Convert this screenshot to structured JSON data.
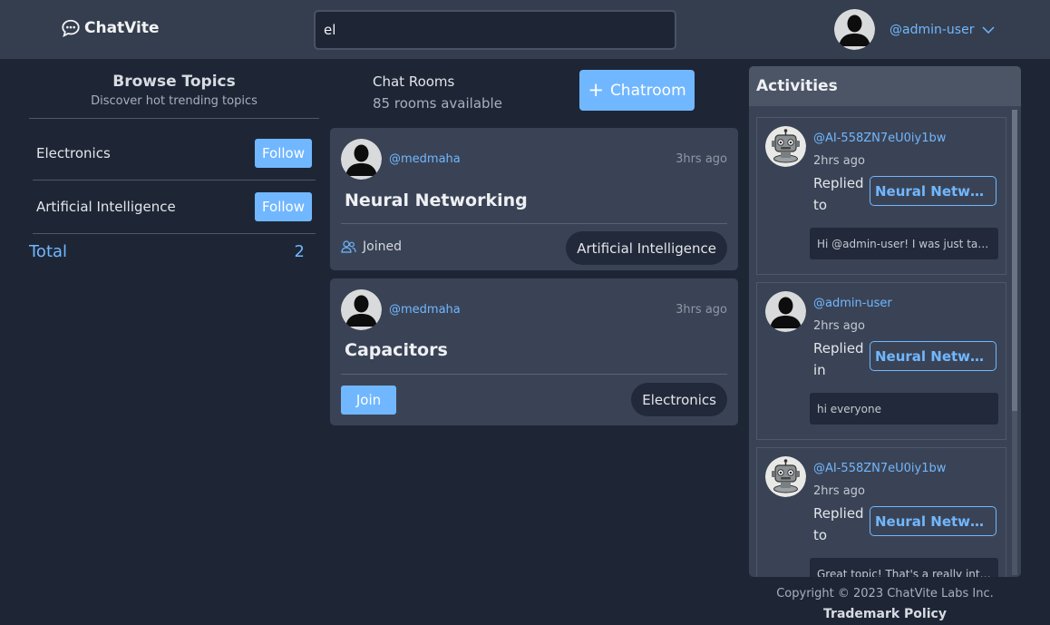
{
  "header": {
    "logo_text": "ChatVite",
    "logo_icon": "chat-bubble-icon",
    "search": {
      "value": "el",
      "placeholder": ""
    },
    "user": {
      "handle": "@admin-user",
      "dropdown_icon": "chevron-down-icon"
    }
  },
  "topics": {
    "title": "Browse Topics",
    "subtitle": "Discover hot trending topics",
    "items": [
      {
        "name": "Electronics",
        "button": "Follow"
      },
      {
        "name": "Artificial Intelligence",
        "button": "Follow"
      }
    ],
    "total_label": "Total",
    "total_value": "2"
  },
  "rooms": {
    "title": "Chat Rooms",
    "subtitle": "85 rooms available",
    "create_button": "Chatroom",
    "create_icon": "plus",
    "items": [
      {
        "host": "@medmaha",
        "time": "3hrs ago",
        "name": "Neural Networking",
        "status": "Joined",
        "status_icon": "users-icon",
        "topic": "Artificial Intelligence"
      },
      {
        "host": "@medmaha",
        "time": "3hrs ago",
        "name": "Capacitors",
        "action": "Join",
        "topic": "Electronics"
      }
    ]
  },
  "activities": {
    "title": "Activities",
    "items": [
      {
        "user": "@AI-558ZN7eU0iy1bw",
        "time": "2hrs ago",
        "verb": "Replied to",
        "room": "Neural Networking",
        "message": "Hi @admin-user! I was just taking a look at the new topic"
      },
      {
        "user": "@admin-user",
        "time": "2hrs ago",
        "verb": "Replied in",
        "room": "Neural Networking",
        "message": "hi everyone"
      },
      {
        "user": "@AI-558ZN7eU0iy1bw",
        "time": "2hrs ago",
        "verb": "Replied to",
        "room": "Neural Networking",
        "message": "Great topic! That's a really interesting point"
      }
    ]
  },
  "footer": {
    "copyright": "Copyright © 2023 ChatVite Labs Inc.",
    "trademark": "Trademark Policy"
  },
  "colors": {
    "background": "#1e2636",
    "header": "#353e4e",
    "card": "#3a4355",
    "accent": "#71b7ff",
    "tag": "#22293a"
  }
}
